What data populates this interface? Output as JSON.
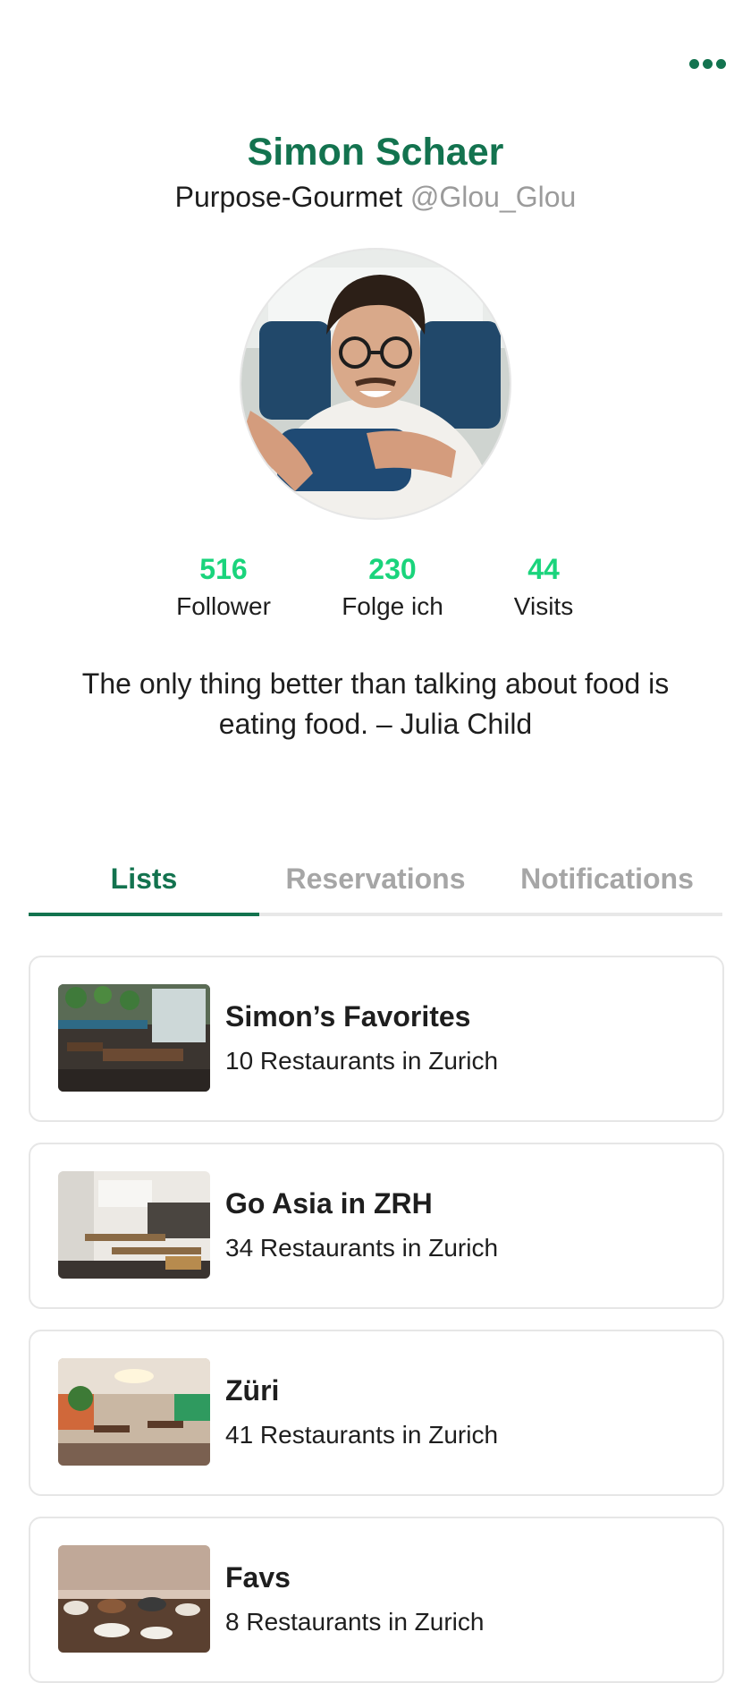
{
  "header": {
    "more_icon": "more-horizontal-icon"
  },
  "profile": {
    "name": "Simon Schaer",
    "title": "Purpose-Gourmet",
    "handle": "@Glou_Glou",
    "avatar_alt": "Simon Schaer",
    "stats": [
      {
        "value": "516",
        "label": "Follower"
      },
      {
        "value": "230",
        "label": "Folge ich"
      },
      {
        "value": "44",
        "label": "Visits"
      }
    ],
    "quote": "The only thing better than talking about food is eating food. – Julia Child"
  },
  "tabs": [
    {
      "label": "Lists",
      "active": true
    },
    {
      "label": "Reservations",
      "active": false
    },
    {
      "label": "Notifications",
      "active": false
    }
  ],
  "lists": [
    {
      "title": "Simon’s Favorites",
      "subtitle": "10 Restaurants in Zurich"
    },
    {
      "title": "Go Asia in ZRH",
      "subtitle": "34 Restaurants in Zurich"
    },
    {
      "title": "Züri",
      "subtitle": "41 Restaurants in Zurich"
    },
    {
      "title": "Favs",
      "subtitle": "8 Restaurants in Zurich"
    }
  ],
  "colors": {
    "brand": "#13734f",
    "stat": "#1ad47c",
    "muted": "#a6a6a6",
    "border": "#e6e6e6"
  }
}
